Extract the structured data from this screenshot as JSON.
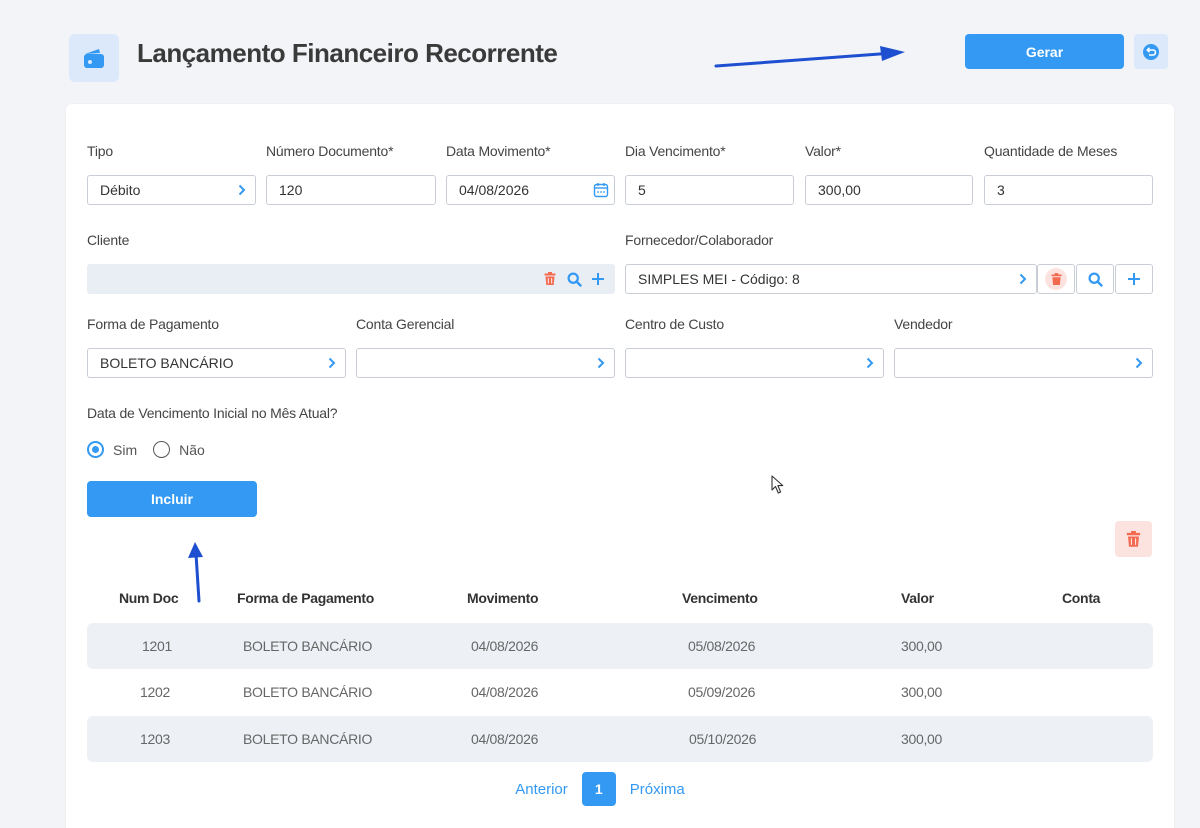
{
  "header": {
    "title": "Lançamento Financeiro Recorrente",
    "generate_label": "Gerar"
  },
  "form": {
    "tipo": {
      "label": "Tipo",
      "value": "Débito"
    },
    "numero_documento": {
      "label": "Número Documento*",
      "value": "120"
    },
    "data_movimento": {
      "label": "Data Movimento*",
      "value": "04/08/2026"
    },
    "dia_vencimento": {
      "label": "Dia Vencimento*",
      "value": "5"
    },
    "valor": {
      "label": "Valor*",
      "value": "300,00"
    },
    "quantidade_meses": {
      "label": "Quantidade de Meses",
      "value": "3"
    },
    "cliente": {
      "label": "Cliente",
      "value": ""
    },
    "fornecedor": {
      "label": "Fornecedor/Colaborador",
      "value": "SIMPLES MEI - Código: 8"
    },
    "forma_pagamento": {
      "label": "Forma de Pagamento",
      "value": "BOLETO BANCÁRIO"
    },
    "conta_gerencial": {
      "label": "Conta Gerencial",
      "value": ""
    },
    "centro_custo": {
      "label": "Centro de Custo",
      "value": ""
    },
    "vendedor": {
      "label": "Vendedor",
      "value": ""
    },
    "vencimento_mes_atual": {
      "question": "Data de Vencimento Inicial no Mês Atual?",
      "options": [
        "Sim",
        "Não"
      ],
      "selected": "Sim"
    },
    "include_label": "Incluir"
  },
  "table": {
    "columns": [
      "Num Doc",
      "Forma de Pagamento",
      "Movimento",
      "Vencimento",
      "Valor",
      "Conta"
    ],
    "rows": [
      {
        "num_doc": "1201",
        "forma": "BOLETO BANCÁRIO",
        "movimento": "04/08/2026",
        "vencimento": "05/08/2026",
        "valor": "300,00",
        "conta": ""
      },
      {
        "num_doc": "1202",
        "forma": "BOLETO BANCÁRIO",
        "movimento": "04/08/2026",
        "vencimento": "05/09/2026",
        "valor": "300,00",
        "conta": ""
      },
      {
        "num_doc": "1203",
        "forma": "BOLETO BANCÁRIO",
        "movimento": "04/08/2026",
        "vencimento": "05/10/2026",
        "valor": "300,00",
        "conta": ""
      }
    ]
  },
  "pagination": {
    "prev": "Anterior",
    "current": "1",
    "next": "Próxima"
  },
  "icons": {
    "header": "wallet-icon",
    "undo": "undo-icon",
    "chevron": "chevron-right-icon",
    "calendar": "calendar-icon",
    "trash": "trash-icon",
    "search": "search-icon",
    "plus": "plus-icon"
  },
  "colors": {
    "primary": "#3399f3",
    "danger": "#f26b50",
    "danger_bg": "#fde3df",
    "icon_bg": "#dbe9fb",
    "row_shade": "#edf1f6"
  }
}
